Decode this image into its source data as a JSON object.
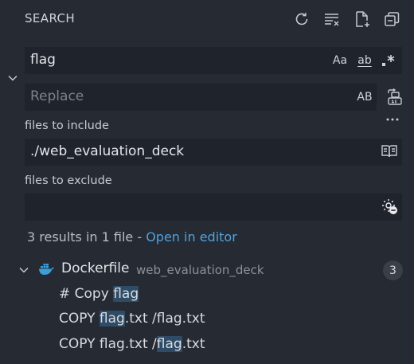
{
  "header": {
    "title": "SEARCH"
  },
  "search": {
    "query": "flag",
    "options": {
      "match_case": "Aa",
      "whole_word": "ab",
      "regex": ".*"
    }
  },
  "replace": {
    "placeholder": "Replace",
    "preserve_case": "AB"
  },
  "include": {
    "label": "files to include",
    "value": "./web_evaluation_deck"
  },
  "exclude": {
    "label": "files to exclude",
    "value": ""
  },
  "summary": {
    "text": "3 results in 1 file - ",
    "link": "Open in editor"
  },
  "results": {
    "file": {
      "name": "Dockerfile",
      "path": "web_evaluation_deck",
      "count": "3"
    },
    "matches": [
      {
        "before": "# Copy ",
        "match": "flag",
        "after": ""
      },
      {
        "before": "COPY ",
        "match": "flag",
        "after": ".txt /flag.txt"
      },
      {
        "before": "COPY flag.txt /",
        "match": "flag",
        "after": ".txt"
      }
    ]
  },
  "colors": {
    "background": "#252a33",
    "input_background": "#1f232b",
    "link": "#4fa3e0",
    "match_highlight": "#2f4c66",
    "docker_blue": "#3a9ed8"
  },
  "icons": {
    "refresh": "refresh-icon",
    "clear": "clear-results-icon",
    "new_search_editor": "new-search-editor-icon",
    "collapse_all": "collapse-all-icon",
    "toggle_replace": "chevron-down-icon",
    "preserve_case": "preserve-case-icon",
    "replace_all": "replace-all-icon",
    "toggle_details": "ellipsis-icon",
    "open_editors_only": "book-icon",
    "use_exclude_settings": "gear-exclude-icon",
    "file_tree_toggle": "chevron-down-icon",
    "docker": "docker-icon"
  }
}
